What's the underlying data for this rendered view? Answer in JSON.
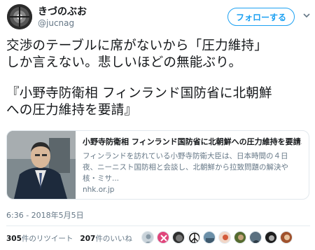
{
  "user": {
    "name": "きづのぶお",
    "handle": "@jucnag"
  },
  "follow_button": {
    "label": "フォローする"
  },
  "tweet": {
    "text": "交渉のテーブルに席がないから「圧力維持」\nしか言えない。悲しいほどの無能ぶり。",
    "quote": "『小野寺防衛相 フィンランド国防省に北朝鮮\nへの圧力維持を要請』"
  },
  "card": {
    "title": "小野寺防衛相 フィンランド国防省に北朝鮮への圧力維持を要請...",
    "description": "フィンランドを訪れている小野寺防衛大臣は、日本時間の４日夜、ニーニスト国防相と会談し、北朝鮮から拉致問題の解決や核・ミサ...",
    "domain": "nhk.or.jp"
  },
  "timestamp": "6:36 - 2018年5月5日",
  "stats": {
    "retweets_count": "305",
    "retweets_label": "件のリツイート",
    "likes_count": "207",
    "likes_label": "件のいいね"
  },
  "likers": [
    "liker-1",
    "liker-2",
    "liker-3",
    "liker-4",
    "liker-5",
    "liker-6",
    "liker-7",
    "liker-8",
    "liker-9",
    "liker-10"
  ]
}
